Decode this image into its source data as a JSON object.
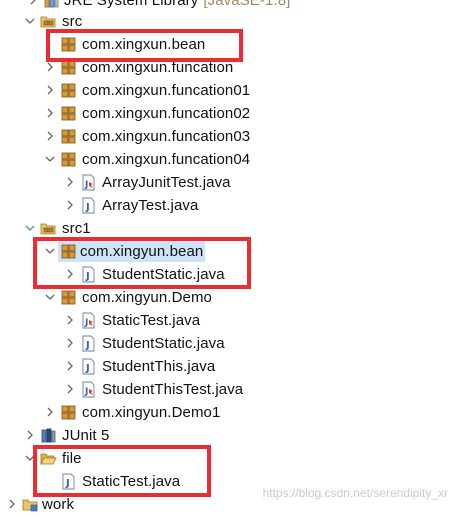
{
  "tree": {
    "jre": {
      "label": "JRE System Library",
      "version": "[JavaSE-1.8]"
    },
    "src": {
      "label": "src",
      "packages": [
        {
          "label": "com.xingxun.bean"
        },
        {
          "label": "com.xingxun.funcation"
        },
        {
          "label": "com.xingxun.funcation01"
        },
        {
          "label": "com.xingxun.funcation02"
        },
        {
          "label": "com.xingxun.funcation03"
        },
        {
          "label": "com.xingxun.funcation04",
          "files": [
            {
              "label": "ArrayJunitTest.java",
              "icon": "junit-class-icon"
            },
            {
              "label": "ArrayTest.java",
              "icon": "java-file-icon"
            }
          ]
        }
      ]
    },
    "src1": {
      "label": "src1",
      "packages": [
        {
          "label": "com.xingyun.bean",
          "files": [
            {
              "label": "StudentStatic.java"
            }
          ]
        },
        {
          "label": "com.xingyun.Demo",
          "files": [
            {
              "label": "StaticTest.java",
              "icon": "junit-class-icon"
            },
            {
              "label": "StudentStatic.java",
              "icon": "java-file-icon"
            },
            {
              "label": "StudentThis.java",
              "icon": "java-file-icon"
            },
            {
              "label": "StudentThisTest.java",
              "icon": "junit-class-icon"
            }
          ]
        },
        {
          "label": "com.xingyun.Demo1"
        }
      ]
    },
    "junit": {
      "label": "JUnit 5"
    },
    "file": {
      "label": "file",
      "files": [
        {
          "label": "StaticTest.java"
        }
      ]
    },
    "work": {
      "label": "work"
    }
  },
  "watermark": "https://blog.csdn.net/serendipity_xr",
  "colors": {
    "highlight": "#ec2c33",
    "selection": "#cfe3f8",
    "package_icon": "#b8832f",
    "java_file_icon": "#3c64b4"
  }
}
